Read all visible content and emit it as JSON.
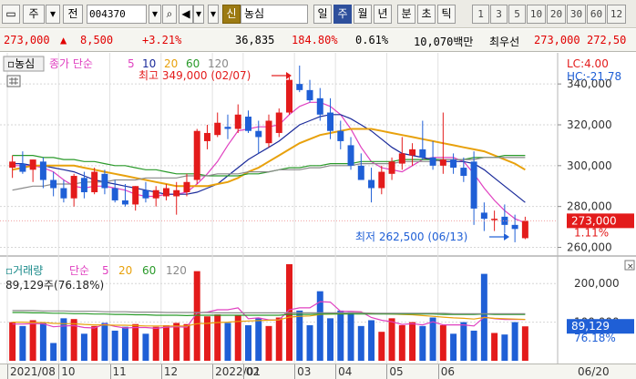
{
  "toolbar": {
    "menu_glyph": "▭",
    "period_type": "주",
    "prev_label": "전",
    "stock_code": "004370",
    "flag_badge": "신",
    "stock_name": "농심",
    "timeframes": [
      {
        "label": "일",
        "active": false
      },
      {
        "label": "주",
        "active": true
      },
      {
        "label": "월",
        "active": false
      },
      {
        "label": "년",
        "active": false
      },
      {
        "label": "분",
        "active": false
      },
      {
        "label": "초",
        "active": false
      },
      {
        "label": "틱",
        "active": false
      }
    ],
    "intervals": [
      "1",
      "3",
      "5",
      "10",
      "20",
      "30",
      "60",
      "12"
    ]
  },
  "quote": {
    "price": "273,000",
    "change_arrow": "▲",
    "change": "8,500",
    "change_pct": "+3.21%",
    "volume": "36,835",
    "volume_ratio": "184.80%",
    "turnover_pct": "0.61%",
    "amount": "10,070백만",
    "best_ask_label": "최우선",
    "best_ask": "273,000",
    "best_bid": "272,50"
  },
  "price_panel": {
    "legend_name": "농심",
    "ma_label": "종가 단순",
    "ma_periods": [
      "5",
      "10",
      "20",
      "60",
      "120"
    ],
    "lc_label": "LC:4.00",
    "hc_label": "HC:-21.78",
    "high_label": "최고 349,000 (02/07)",
    "low_label": "최저 262,500 (06/13)",
    "y_ticks": [
      "340,000",
      "320,000",
      "300,000",
      "280,000",
      "260,000"
    ],
    "current_price_box": "273,000",
    "current_pct": "1.11%"
  },
  "volume_panel": {
    "legend_label": "거래량",
    "ma_label": "단순",
    "ma_periods": [
      "5",
      "20",
      "60",
      "120"
    ],
    "last_volume": "89,129주(76.18%)",
    "y_ticks": [
      "200,000",
      "100,000"
    ],
    "value_box": "89,129",
    "value_pct": "76.18%"
  },
  "x_axis_labels": [
    "2021/08",
    "10",
    "11",
    "12",
    "2022/01",
    "02",
    "03",
    "04",
    "05",
    "06",
    "06/20"
  ],
  "colors": {
    "up": "#e31b1b",
    "down": "#1f5fd6",
    "ma5": "#e040c0",
    "ma10": "#1a2a9a",
    "ma20": "#e8a10c",
    "ma60": "#2a9a2a",
    "ma120": "#8a8a8a"
  },
  "chart_data": {
    "type": "candlestick",
    "title": "농심",
    "interval": "주",
    "ylim": [
      258000,
      353000
    ],
    "candles": [
      {
        "o": 299000,
        "h": 305000,
        "l": 294000,
        "c": 302000
      },
      {
        "o": 301000,
        "h": 307000,
        "l": 296000,
        "c": 297000
      },
      {
        "o": 298000,
        "h": 303000,
        "l": 292000,
        "c": 303000
      },
      {
        "o": 302000,
        "h": 304000,
        "l": 289000,
        "c": 293000
      },
      {
        "o": 293000,
        "h": 297000,
        "l": 285000,
        "c": 289000
      },
      {
        "o": 289000,
        "h": 293000,
        "l": 282000,
        "c": 284000
      },
      {
        "o": 284000,
        "h": 296000,
        "l": 280000,
        "c": 295000
      },
      {
        "o": 294000,
        "h": 297000,
        "l": 284000,
        "c": 287000
      },
      {
        "o": 287000,
        "h": 299000,
        "l": 286000,
        "c": 297000
      },
      {
        "o": 296000,
        "h": 298000,
        "l": 286000,
        "c": 289000
      },
      {
        "o": 289000,
        "h": 293000,
        "l": 282000,
        "c": 283000
      },
      {
        "o": 283000,
        "h": 291000,
        "l": 280000,
        "c": 281000
      },
      {
        "o": 281000,
        "h": 290000,
        "l": 278000,
        "c": 290000
      },
      {
        "o": 288000,
        "h": 292000,
        "l": 282000,
        "c": 284000
      },
      {
        "o": 284000,
        "h": 290000,
        "l": 280000,
        "c": 288000
      },
      {
        "o": 285000,
        "h": 291000,
        "l": 283000,
        "c": 289000
      },
      {
        "o": 285000,
        "h": 292000,
        "l": 276000,
        "c": 288000
      },
      {
        "o": 287000,
        "h": 296000,
        "l": 285000,
        "c": 292000
      },
      {
        "o": 293000,
        "h": 318000,
        "l": 291000,
        "c": 317000
      },
      {
        "o": 312000,
        "h": 320000,
        "l": 308000,
        "c": 316000
      },
      {
        "o": 315000,
        "h": 326000,
        "l": 314000,
        "c": 321000
      },
      {
        "o": 319000,
        "h": 325000,
        "l": 313000,
        "c": 318000
      },
      {
        "o": 318000,
        "h": 330000,
        "l": 316000,
        "c": 325000
      },
      {
        "o": 324000,
        "h": 327000,
        "l": 316000,
        "c": 317000
      },
      {
        "o": 317000,
        "h": 322000,
        "l": 306000,
        "c": 314000
      },
      {
        "o": 311000,
        "h": 325000,
        "l": 309000,
        "c": 322000
      },
      {
        "o": 316000,
        "h": 328000,
        "l": 314000,
        "c": 326000
      },
      {
        "o": 326000,
        "h": 344000,
        "l": 325000,
        "c": 342000
      },
      {
        "o": 340000,
        "h": 349000,
        "l": 336000,
        "c": 337000
      },
      {
        "o": 337000,
        "h": 342000,
        "l": 331000,
        "c": 332000
      },
      {
        "o": 333000,
        "h": 338000,
        "l": 322000,
        "c": 325000
      },
      {
        "o": 326000,
        "h": 333000,
        "l": 313000,
        "c": 317000
      },
      {
        "o": 317000,
        "h": 322000,
        "l": 308000,
        "c": 312000
      },
      {
        "o": 310000,
        "h": 314000,
        "l": 298000,
        "c": 300000
      },
      {
        "o": 300000,
        "h": 306000,
        "l": 295000,
        "c": 293000
      },
      {
        "o": 293000,
        "h": 299000,
        "l": 282000,
        "c": 289000
      },
      {
        "o": 289000,
        "h": 300000,
        "l": 286000,
        "c": 297000
      },
      {
        "o": 296000,
        "h": 304000,
        "l": 293000,
        "c": 302000
      },
      {
        "o": 301000,
        "h": 314000,
        "l": 298000,
        "c": 306000
      },
      {
        "o": 305000,
        "h": 311000,
        "l": 300000,
        "c": 308000
      },
      {
        "o": 308000,
        "h": 322000,
        "l": 303000,
        "c": 304000
      },
      {
        "o": 304000,
        "h": 312000,
        "l": 298000,
        "c": 300000
      },
      {
        "o": 300000,
        "h": 326000,
        "l": 296000,
        "c": 303000
      },
      {
        "o": 303000,
        "h": 306000,
        "l": 296000,
        "c": 299000
      },
      {
        "o": 299000,
        "h": 304000,
        "l": 292000,
        "c": 295000
      },
      {
        "o": 302000,
        "h": 307000,
        "l": 271000,
        "c": 279000
      },
      {
        "o": 277000,
        "h": 282000,
        "l": 268000,
        "c": 274000
      },
      {
        "o": 274000,
        "h": 278000,
        "l": 268000,
        "c": 274000
      },
      {
        "o": 275000,
        "h": 281000,
        "l": 267000,
        "c": 271000
      },
      {
        "o": 271000,
        "h": 276000,
        "l": 262500,
        "c": 269000
      },
      {
        "o": 264500,
        "h": 275000,
        "l": 264000,
        "c": 273000
      }
    ],
    "ma_series": [
      {
        "name": "5",
        "values": [
          300000,
          300000,
          300000,
          299000,
          297000,
          293000,
          290000,
          289000,
          290000,
          290000,
          289000,
          288000,
          286000,
          285000,
          285000,
          286000,
          286000,
          287000,
          291000,
          296000,
          302000,
          310000,
          317000,
          318000,
          319000,
          319000,
          320000,
          325000,
          329000,
          331000,
          331000,
          329000,
          325000,
          318000,
          309000,
          302000,
          299000,
          298000,
          297000,
          300000,
          303000,
          304000,
          304000,
          304000,
          302000,
          296000,
          289000,
          283000,
          278000,
          274000,
          272000
        ]
      },
      {
        "name": "10",
        "values": [
          301000,
          301000,
          300000,
          300000,
          299000,
          298000,
          297000,
          295000,
          293000,
          292000,
          291000,
          290000,
          289000,
          288000,
          287000,
          286000,
          286000,
          286000,
          287000,
          289000,
          291000,
          295000,
          299000,
          303000,
          306000,
          309000,
          312000,
          316000,
          320000,
          322000,
          324000,
          325000,
          325000,
          323000,
          320000,
          317000,
          313000,
          309000,
          306000,
          305000,
          304000,
          303000,
          302000,
          302000,
          302000,
          301000,
          298000,
          294000,
          290000,
          286000,
          282000
        ]
      },
      {
        "name": "20",
        "values": [
          298000,
          299000,
          300000,
          300000,
          300000,
          300000,
          300000,
          299000,
          298000,
          297000,
          296000,
          295000,
          294000,
          293000,
          292000,
          291000,
          290000,
          290000,
          290000,
          290000,
          291000,
          292000,
          294000,
          297000,
          299000,
          302000,
          305000,
          308000,
          311000,
          313000,
          315000,
          316000,
          317000,
          318000,
          318000,
          318000,
          317000,
          316000,
          315000,
          314000,
          313000,
          312000,
          311000,
          310000,
          309000,
          308000,
          307000,
          305000,
          303000,
          301000,
          298000
        ]
      },
      {
        "name": "60",
        "values": [
          305000,
          305000,
          305000,
          304000,
          304000,
          303000,
          303000,
          302000,
          302000,
          301000,
          300000,
          300000,
          299000,
          298000,
          298000,
          297000,
          296000,
          296000,
          296000,
          295000,
          295000,
          295000,
          295000,
          296000,
          296000,
          297000,
          298000,
          299000,
          299000,
          300000,
          300000,
          301000,
          301000,
          301000,
          302000,
          302000,
          302000,
          302000,
          303000,
          303000,
          303000,
          303000,
          303000,
          303000,
          303000,
          304000,
          304000,
          304000,
          305000,
          305000,
          305000
        ]
      },
      {
        "name": "120",
        "values": [
          288000,
          289000,
          290000,
          290000,
          291000,
          291000,
          291000,
          292000,
          292000,
          292000,
          293000,
          293000,
          293000,
          294000,
          294000,
          294000,
          294000,
          295000,
          295000,
          295000,
          296000,
          296000,
          296000,
          297000,
          297000,
          297000,
          298000,
          298000,
          298000,
          299000,
          299000,
          300000,
          300000,
          300000,
          301000,
          301000,
          301000,
          301000,
          302000,
          302000,
          302000,
          302000,
          303000,
          303000,
          303000,
          303000,
          304000,
          304000,
          304000,
          304000,
          304000
        ]
      }
    ],
    "volume": {
      "ylim": [
        0,
        250000
      ],
      "values": [
        100000,
        90000,
        105000,
        98000,
        46000,
        110000,
        108000,
        70000,
        90000,
        98000,
        78000,
        88000,
        95000,
        70000,
        88000,
        92000,
        98000,
        95000,
        232000,
        115000,
        120000,
        98000,
        118000,
        92000,
        110000,
        90000,
        112000,
        250000,
        130000,
        92000,
        180000,
        110000,
        130000,
        126000,
        90000,
        105000,
        75000,
        110000,
        92000,
        100000,
        90000,
        112000,
        92000,
        70000,
        100000,
        78000,
        225000,
        72000,
        68000,
        100000,
        89129
      ],
      "ma_series": [
        {
          "name": "5",
          "values": [
            95000,
            95000,
            96000,
            96000,
            88000,
            90000,
            91000,
            86000,
            85000,
            95000,
            89000,
            85000,
            86000,
            86000,
            84000,
            87000,
            88000,
            87000,
            124000,
            126000,
            132000,
            132000,
            137000,
            109000,
            111000,
            106000,
            106000,
            132000,
            137000,
            137000,
            153000,
            152000,
            128000,
            128000,
            127000,
            112000,
            105000,
            101000,
            94000,
            96000,
            93000,
            101000,
            93000,
            93000,
            93000,
            90000,
            113000,
            109000,
            107000,
            107000,
            107000
          ]
        },
        {
          "name": "20",
          "values": [
            100000,
            100000,
            99000,
            99000,
            97000,
            96000,
            96000,
            94000,
            93000,
            93000,
            92000,
            92000,
            91000,
            90000,
            90000,
            90000,
            90000,
            90000,
            96000,
            97000,
            99000,
            100000,
            102000,
            103000,
            104000,
            105000,
            106000,
            113000,
            115000,
            116000,
            120000,
            121000,
            122000,
            124000,
            124000,
            123000,
            122000,
            121000,
            120000,
            119000,
            117000,
            115000,
            113000,
            111000,
            110000,
            108000,
            112000,
            110000,
            109000,
            108000,
            107000
          ]
        },
        {
          "name": "60",
          "values": [
            125000,
            125000,
            124000,
            124000,
            123000,
            123000,
            122000,
            122000,
            121000,
            121000,
            120000,
            120000,
            119000,
            119000,
            118000,
            118000,
            118000,
            117000,
            118000,
            118000,
            118000,
            118000,
            118000,
            118000,
            118000,
            118000,
            118000,
            120000,
            120000,
            120000,
            121000,
            121000,
            121000,
            121000,
            121000,
            121000,
            121000,
            121000,
            121000,
            121000,
            121000,
            121000,
            120000,
            120000,
            120000,
            120000,
            121000,
            120000,
            120000,
            120000,
            120000
          ]
        },
        {
          "name": "120",
          "values": [
            130000,
            130000,
            130000,
            129000,
            129000,
            129000,
            128000,
            128000,
            128000,
            127000,
            127000,
            127000,
            126000,
            126000,
            126000,
            125000,
            125000,
            125000,
            125000,
            125000,
            124000,
            124000,
            124000,
            124000,
            124000,
            124000,
            124000,
            124000,
            124000,
            124000,
            124000,
            124000,
            124000,
            124000,
            124000,
            123000,
            123000,
            123000,
            123000,
            123000,
            123000,
            123000,
            123000,
            122000,
            122000,
            122000,
            122000,
            122000,
            122000,
            122000,
            122000
          ]
        }
      ]
    }
  }
}
